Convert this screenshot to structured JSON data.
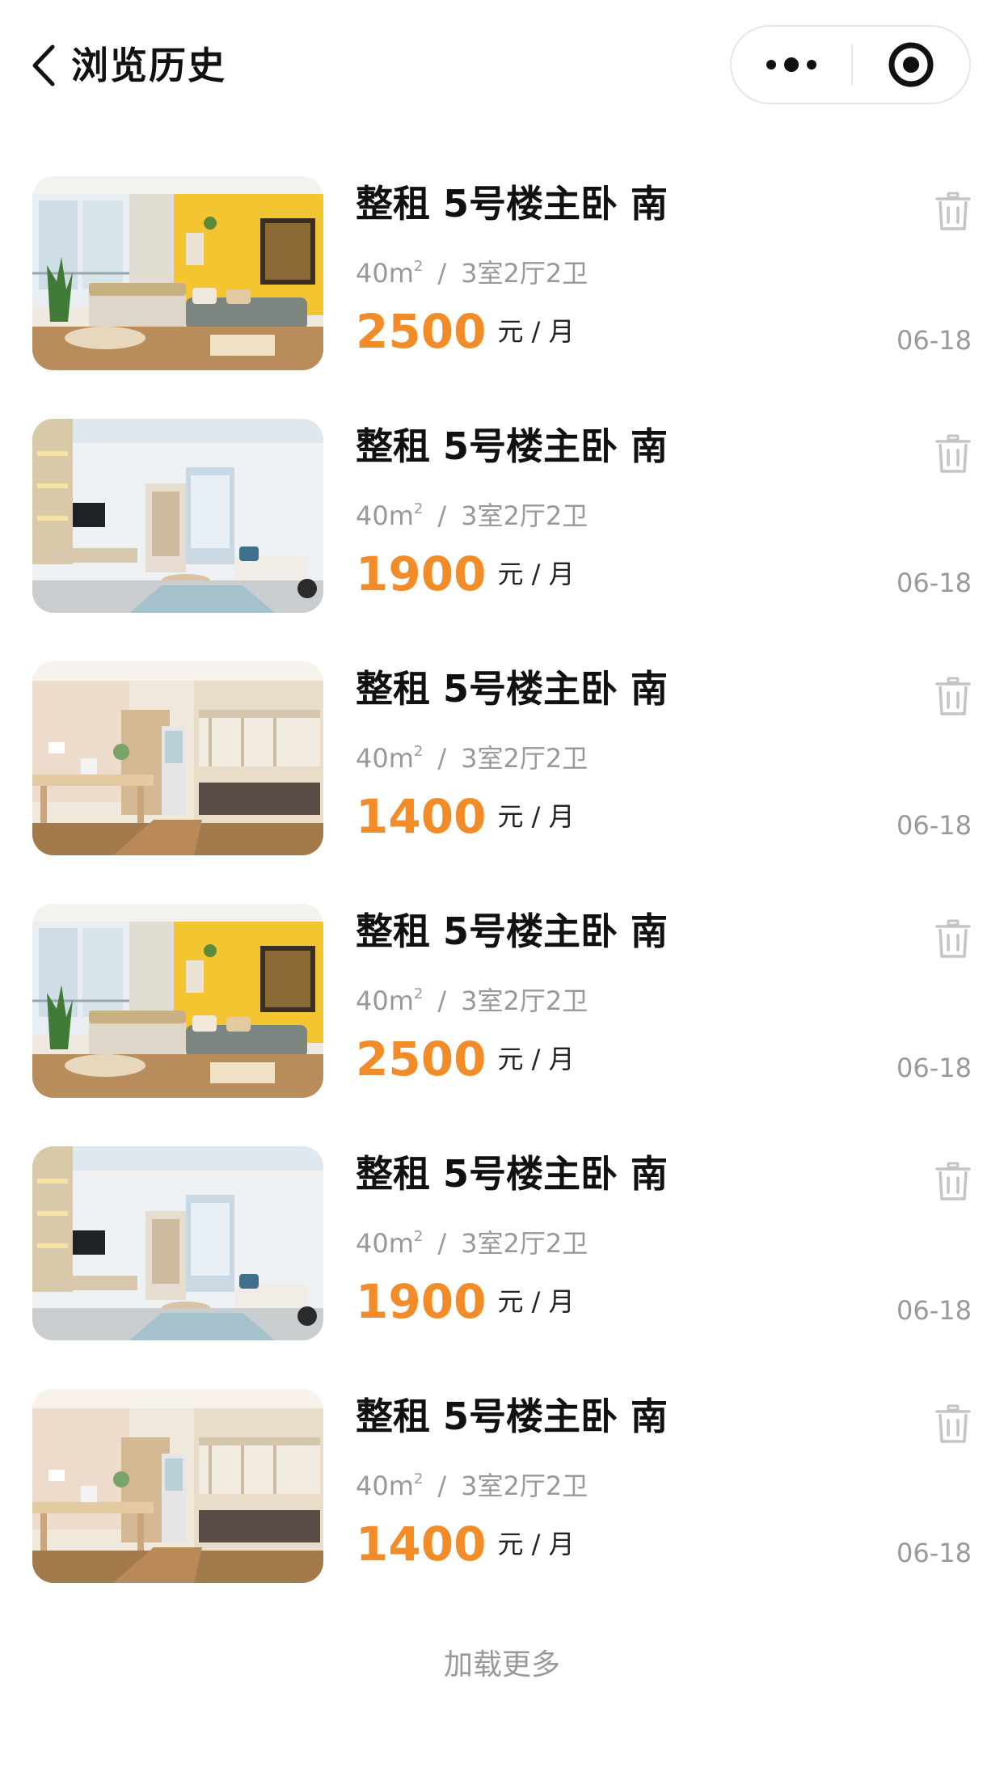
{
  "header": {
    "title": "浏览历史",
    "back_icon": "chevron-left-icon",
    "more_icon": "more-dots-icon",
    "close_icon": "target-circle-icon"
  },
  "colors": {
    "price": "#f28c28",
    "muted": "#999999",
    "title": "#111111"
  },
  "listings": [
    {
      "title": "整租 5号楼主卧 南",
      "area_value": "40m",
      "area_sup": "2",
      "separator": "/",
      "layout": "3室2厅2卫",
      "price": "2500",
      "unit": "元 / 月",
      "date": "06-18",
      "image": "yellow-wall-studio-photo"
    },
    {
      "title": "整租 5号楼主卧 南",
      "area_value": "40m",
      "area_sup": "2",
      "separator": "/",
      "layout": "3室2厅2卫",
      "price": "1900",
      "unit": "元 / 月",
      "date": "06-18",
      "image": "white-studio-photo"
    },
    {
      "title": "整租 5号楼主卧 南",
      "area_value": "40m",
      "area_sup": "2",
      "separator": "/",
      "layout": "3室2厅2卫",
      "price": "1400",
      "unit": "元 / 月",
      "date": "06-18",
      "image": "bunk-bed-room-photo"
    },
    {
      "title": "整租 5号楼主卧 南",
      "area_value": "40m",
      "area_sup": "2",
      "separator": "/",
      "layout": "3室2厅2卫",
      "price": "2500",
      "unit": "元 / 月",
      "date": "06-18",
      "image": "yellow-wall-studio-photo"
    },
    {
      "title": "整租 5号楼主卧 南",
      "area_value": "40m",
      "area_sup": "2",
      "separator": "/",
      "layout": "3室2厅2卫",
      "price": "1900",
      "unit": "元 / 月",
      "date": "06-18",
      "image": "white-studio-photo"
    },
    {
      "title": "整租 5号楼主卧 南",
      "area_value": "40m",
      "area_sup": "2",
      "separator": "/",
      "layout": "3室2厅2卫",
      "price": "1400",
      "unit": "元 / 月",
      "date": "06-18",
      "image": "bunk-bed-room-photo"
    }
  ],
  "footer": {
    "load_more": "加载更多"
  }
}
